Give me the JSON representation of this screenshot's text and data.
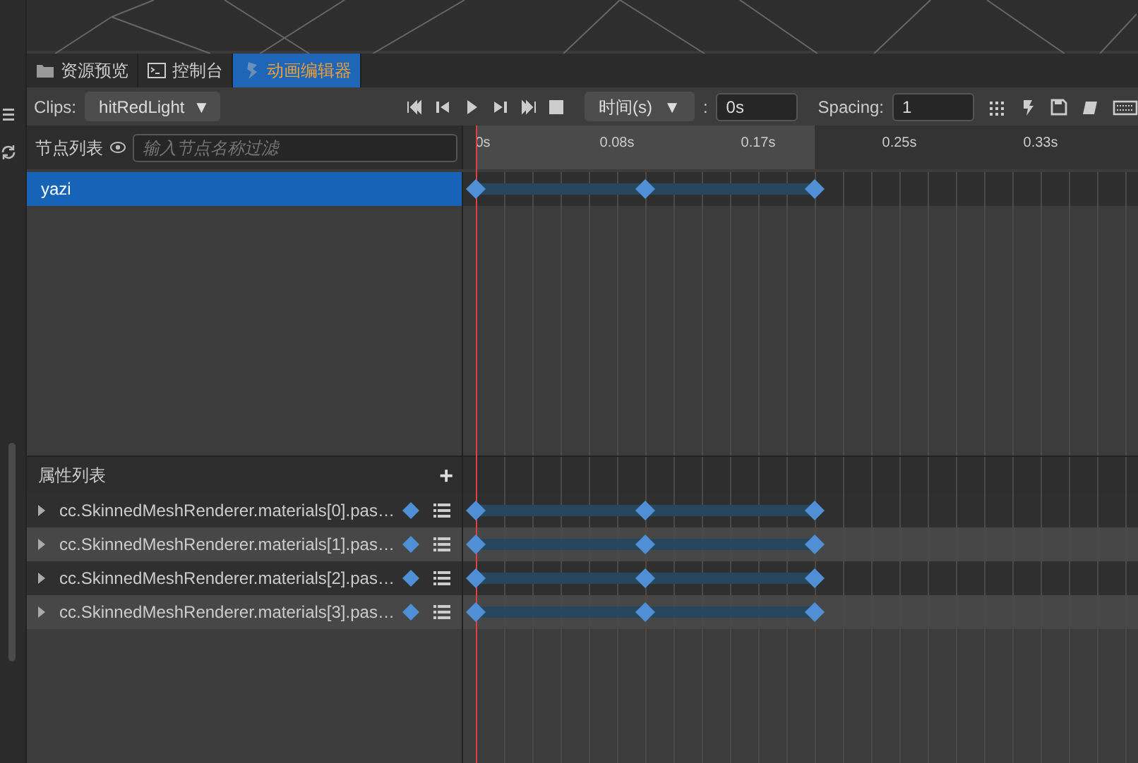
{
  "tabs": [
    {
      "label": "资源预览",
      "selected": false
    },
    {
      "label": "控制台",
      "selected": false
    },
    {
      "label": "动画编辑器",
      "selected": true
    }
  ],
  "toolbar": {
    "clips_label": "Clips:",
    "clip": "hitRedLight",
    "clip_arrow": "▼",
    "time_mode": "时间(s)",
    "time_arrow": "▼",
    "colon": ":",
    "time_value": "0s",
    "spacing_label": "Spacing:",
    "spacing_value": "1"
  },
  "node_list": {
    "title": "节点列表",
    "filter_placeholder": "输入节点名称过滤",
    "nodes": [
      {
        "name": "yazi",
        "selected": true
      }
    ]
  },
  "ruler": {
    "ticks": [
      "0s",
      "0.08s",
      "0.17s",
      "0.25s",
      "0.33s"
    ]
  },
  "property_list": {
    "title": "属性列表",
    "add": "+",
    "properties": [
      {
        "name": "cc.SkinnedMeshRenderer.materials[0].pas…"
      },
      {
        "name": "cc.SkinnedMeshRenderer.materials[1].pas…"
      },
      {
        "name": "cc.SkinnedMeshRenderer.materials[2].pas…"
      },
      {
        "name": "cc.SkinnedMeshRenderer.materials[3].pas…"
      }
    ]
  }
}
